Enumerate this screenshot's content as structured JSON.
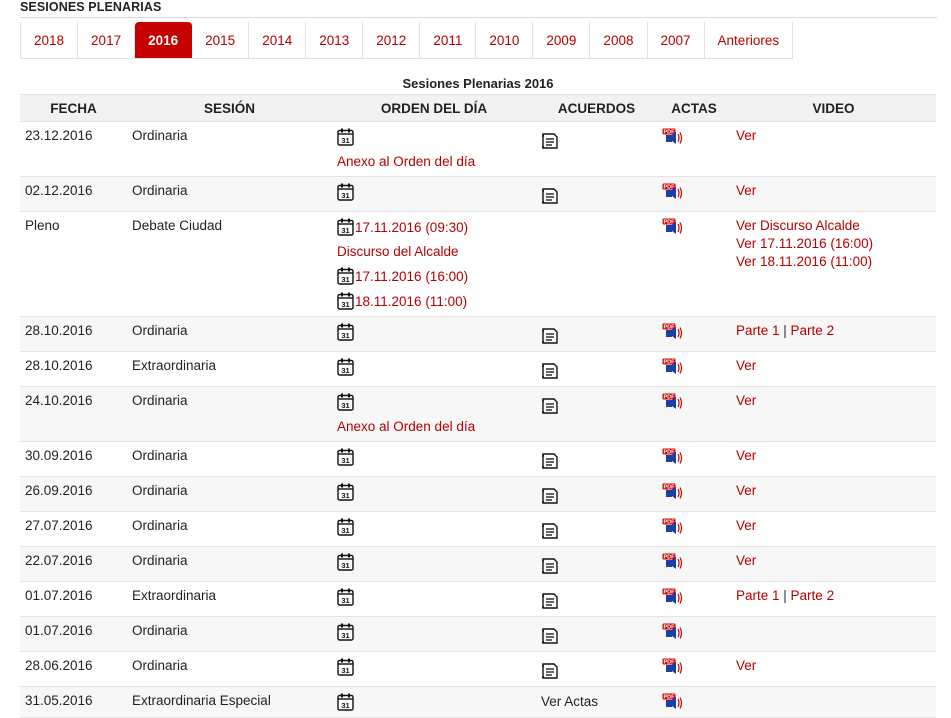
{
  "page": {
    "title": "SESIONES PLENARIAS"
  },
  "tabs": [
    {
      "label": "2018",
      "active": false
    },
    {
      "label": "2017",
      "active": false
    },
    {
      "label": "2016",
      "active": true
    },
    {
      "label": "2015",
      "active": false
    },
    {
      "label": "2014",
      "active": false
    },
    {
      "label": "2013",
      "active": false
    },
    {
      "label": "2012",
      "active": false
    },
    {
      "label": "2011",
      "active": false
    },
    {
      "label": "2010",
      "active": false
    },
    {
      "label": "2009",
      "active": false
    },
    {
      "label": "2008",
      "active": false
    },
    {
      "label": "2007",
      "active": false
    },
    {
      "label": "Anteriores",
      "active": false
    }
  ],
  "table": {
    "caption": "Sesiones Plenarias 2016",
    "headers": {
      "fecha": "FECHA",
      "sesion": "SESIÓN",
      "orden": "ORDEN DEL DÍA",
      "acuerdos": "ACUERDOS",
      "actas": "ACTAS",
      "video": "VIDEO"
    },
    "icons": {
      "orden": "calendar-31-icon",
      "acuerdos": "document-icon",
      "actas": "pdf-audio-icon"
    },
    "colors": {
      "link": "#b60000",
      "active_tab": "#c40000",
      "header_bg": "#f2f2f2",
      "alt_row": "#f7f7f7"
    },
    "rows": [
      {
        "fecha": "23.12.2016",
        "sesion": "Ordinaria",
        "orden": [
          {
            "icon": true
          },
          {
            "text": "Anexo al Orden del día"
          }
        ],
        "acuerdos": {
          "icon": true
        },
        "actas": true,
        "video": [
          [
            "Ver"
          ]
        ]
      },
      {
        "fecha": "02.12.2016",
        "sesion": "Ordinaria",
        "orden": [
          {
            "icon": true
          }
        ],
        "acuerdos": {
          "icon": true
        },
        "actas": true,
        "video": [
          [
            "Ver"
          ]
        ]
      },
      {
        "fecha": "Pleno",
        "sesion": "Debate Ciudad",
        "orden": [
          {
            "icon": true,
            "text": "17.11.2016 (09:30)"
          },
          {
            "text": "Discurso del Alcalde"
          },
          {
            "icon": true,
            "text": "17.11.2016 (16:00)"
          },
          {
            "icon": true,
            "text": "18.11.2016 (11:00)"
          }
        ],
        "acuerdos": null,
        "actas": true,
        "video": [
          [
            "Ver Discurso Alcalde"
          ],
          [
            "Ver 17.11.2016 (16:00)"
          ],
          [
            "Ver 18.11.2016 (11:00)"
          ]
        ]
      },
      {
        "fecha": "28.10.2016",
        "sesion": "Ordinaria",
        "orden": [
          {
            "icon": true
          }
        ],
        "acuerdos": {
          "icon": true
        },
        "actas": true,
        "video": [
          [
            "Parte 1",
            "Parte 2"
          ]
        ]
      },
      {
        "fecha": "28.10.2016",
        "sesion": "Extraordinaria",
        "orden": [
          {
            "icon": true
          }
        ],
        "acuerdos": {
          "icon": true
        },
        "actas": true,
        "video": [
          [
            "Ver"
          ]
        ]
      },
      {
        "fecha": "24.10.2016",
        "sesion": "Ordinaria",
        "orden": [
          {
            "icon": true
          },
          {
            "text": "Anexo al Orden del día"
          }
        ],
        "acuerdos": {
          "icon": true
        },
        "actas": true,
        "video": [
          [
            "Ver"
          ]
        ]
      },
      {
        "fecha": "30.09.2016",
        "sesion": "Ordinaria",
        "orden": [
          {
            "icon": true
          }
        ],
        "acuerdos": {
          "icon": true
        },
        "actas": true,
        "video": [
          [
            "Ver"
          ]
        ]
      },
      {
        "fecha": "26.09.2016",
        "sesion": "Ordinaria",
        "orden": [
          {
            "icon": true
          }
        ],
        "acuerdos": {
          "icon": true
        },
        "actas": true,
        "video": [
          [
            "Ver"
          ]
        ]
      },
      {
        "fecha": "27.07.2016",
        "sesion": "Ordinaria",
        "orden": [
          {
            "icon": true
          }
        ],
        "acuerdos": {
          "icon": true
        },
        "actas": true,
        "video": [
          [
            "Ver"
          ]
        ]
      },
      {
        "fecha": "22.07.2016",
        "sesion": "Ordinaria",
        "orden": [
          {
            "icon": true
          }
        ],
        "acuerdos": {
          "icon": true
        },
        "actas": true,
        "video": [
          [
            "Ver"
          ]
        ]
      },
      {
        "fecha": "01.07.2016",
        "sesion": "Extraordinaria",
        "orden": [
          {
            "icon": true
          }
        ],
        "acuerdos": {
          "icon": true
        },
        "actas": true,
        "video": [
          [
            "Parte 1",
            "Parte 2"
          ]
        ]
      },
      {
        "fecha": "01.07.2016",
        "sesion": "Ordinaria",
        "orden": [
          {
            "icon": true
          }
        ],
        "acuerdos": {
          "icon": true
        },
        "actas": true,
        "video": []
      },
      {
        "fecha": "28.06.2016",
        "sesion": "Ordinaria",
        "orden": [
          {
            "icon": true
          }
        ],
        "acuerdos": {
          "icon": true
        },
        "actas": true,
        "video": [
          [
            "Ver"
          ]
        ]
      },
      {
        "fecha": "31.05.2016",
        "sesion": "Extraordinaria Especial",
        "orden": [
          {
            "icon": true
          }
        ],
        "acuerdos": {
          "text": "Ver Actas"
        },
        "actas": true,
        "video": []
      }
    ]
  }
}
